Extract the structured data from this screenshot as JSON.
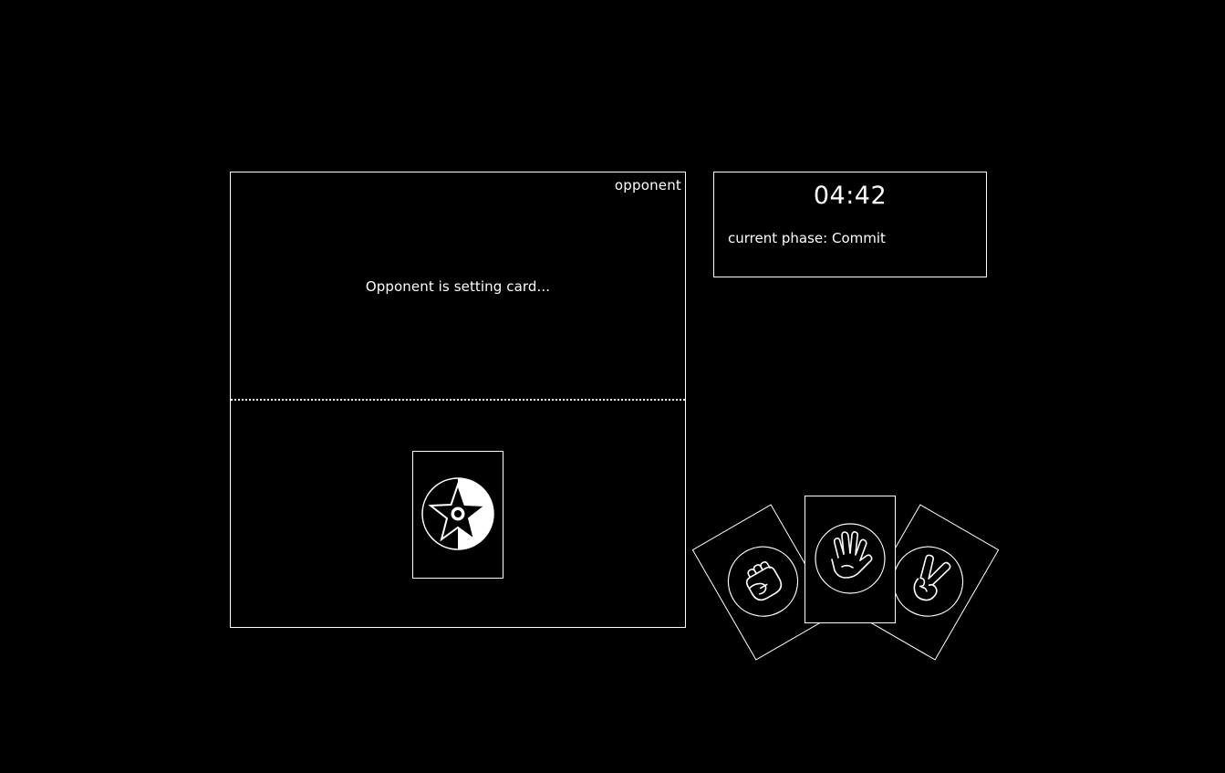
{
  "board": {
    "label": "opponent",
    "opponent_status": "Opponent is setting card..."
  },
  "played_card": {
    "icon": "star-yin-yang-icon",
    "face": "hidden"
  },
  "info": {
    "timer": "04:42",
    "phase": "current phase: Commit"
  },
  "hand": {
    "cards": [
      {
        "name": "rock",
        "icon": "fist-icon"
      },
      {
        "name": "paper",
        "icon": "open-hand-icon"
      },
      {
        "name": "scissors",
        "icon": "peace-sign-icon"
      }
    ]
  },
  "colors": {
    "background": "#000000",
    "foreground": "#ffffff"
  }
}
